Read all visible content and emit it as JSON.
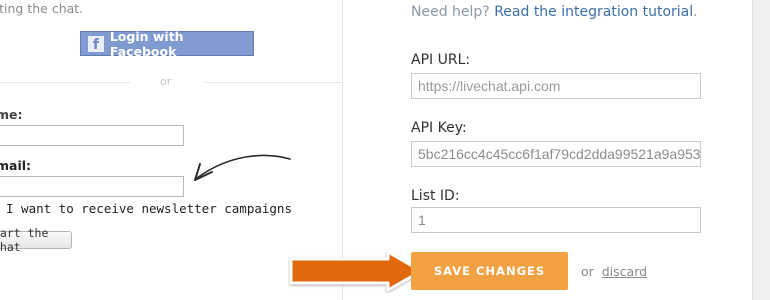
{
  "left": {
    "intro_text": "rting the chat.",
    "facebook_button": "Login with Facebook",
    "or_text": "or",
    "name_label": "me:",
    "email_label": "mail:",
    "newsletter_text": "I want to receive newsletter campaigns",
    "start_button": "tart the chat"
  },
  "right": {
    "help_text": "Need help? ",
    "help_link": "Read the integration tutorial",
    "help_suffix": ".",
    "api_url_label": "API URL:",
    "api_url_placeholder": "https://livechat.api.com",
    "api_key_label": "API Key:",
    "api_key_value": "5bc216cc4c45cc6f1af79cd2dda99521a9a953",
    "list_id_label": "List ID:",
    "list_id_value": "1",
    "save_button": "SAVE CHANGES",
    "or_text": "or",
    "discard_link": "discard"
  },
  "colors": {
    "accent_orange": "#f2a142",
    "arrow_orange": "#e0680f",
    "facebook_blue": "#7f9bd0",
    "link_blue": "#3c6fa6"
  }
}
